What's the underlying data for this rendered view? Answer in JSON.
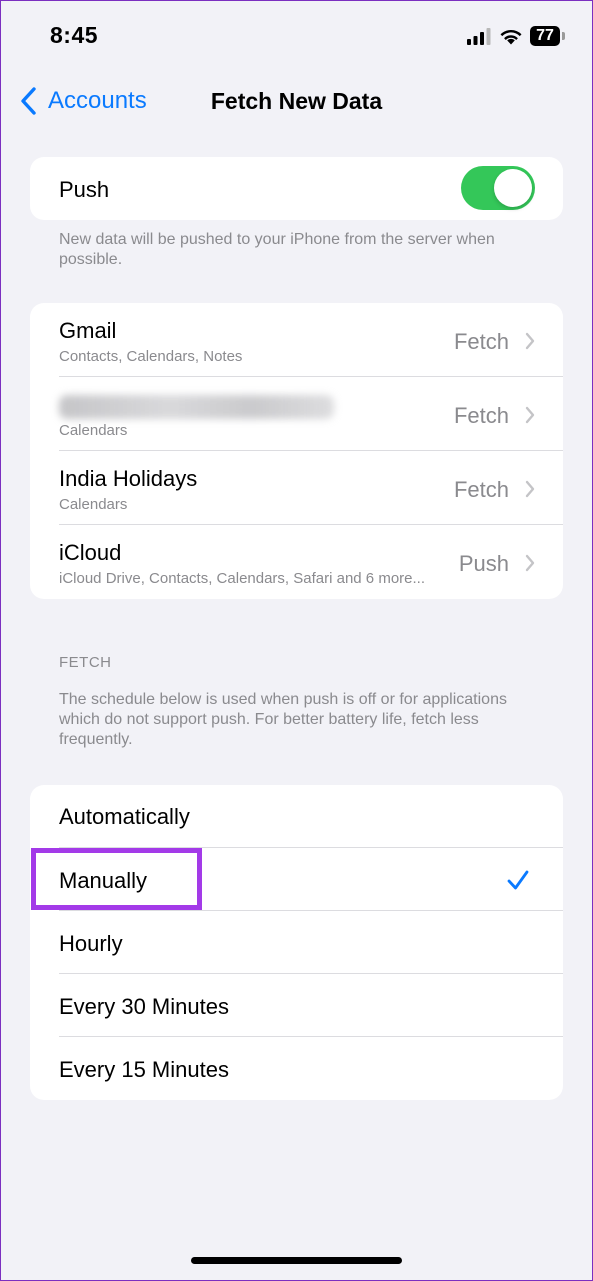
{
  "status_bar": {
    "time": "8:45",
    "battery": "77",
    "icons": [
      "cellular-signal-icon",
      "wifi-icon",
      "battery-icon"
    ]
  },
  "nav": {
    "back_label": "Accounts",
    "title": "Fetch New Data",
    "back_icon": "chevron-left-icon"
  },
  "push": {
    "label": "Push",
    "enabled": true,
    "footnote": "New data will be pushed to your iPhone from the server when possible."
  },
  "accounts": [
    {
      "name": "Gmail",
      "detail": "Contacts, Calendars, Notes",
      "value": "Fetch",
      "blurred": false
    },
    {
      "name": "",
      "detail": "Calendars",
      "value": "Fetch",
      "blurred": true
    },
    {
      "name": "India Holidays",
      "detail": "Calendars",
      "value": "Fetch",
      "blurred": false
    },
    {
      "name": "iCloud",
      "detail": "iCloud Drive, Contacts, Calendars, Safari and 6 more...",
      "value": "Push",
      "blurred": false
    }
  ],
  "fetch": {
    "header": "FETCH",
    "description": "The schedule below is used when push is off or for applications which do not support push. For better battery life, fetch less frequently.",
    "options": [
      "Automatically",
      "Manually",
      "Hourly",
      "Every 30 Minutes",
      "Every 15 Minutes"
    ],
    "selected": "Manually"
  },
  "colors": {
    "accent": "#0a7aff",
    "toggle_on": "#34c759",
    "highlight": "#a33ae8"
  }
}
